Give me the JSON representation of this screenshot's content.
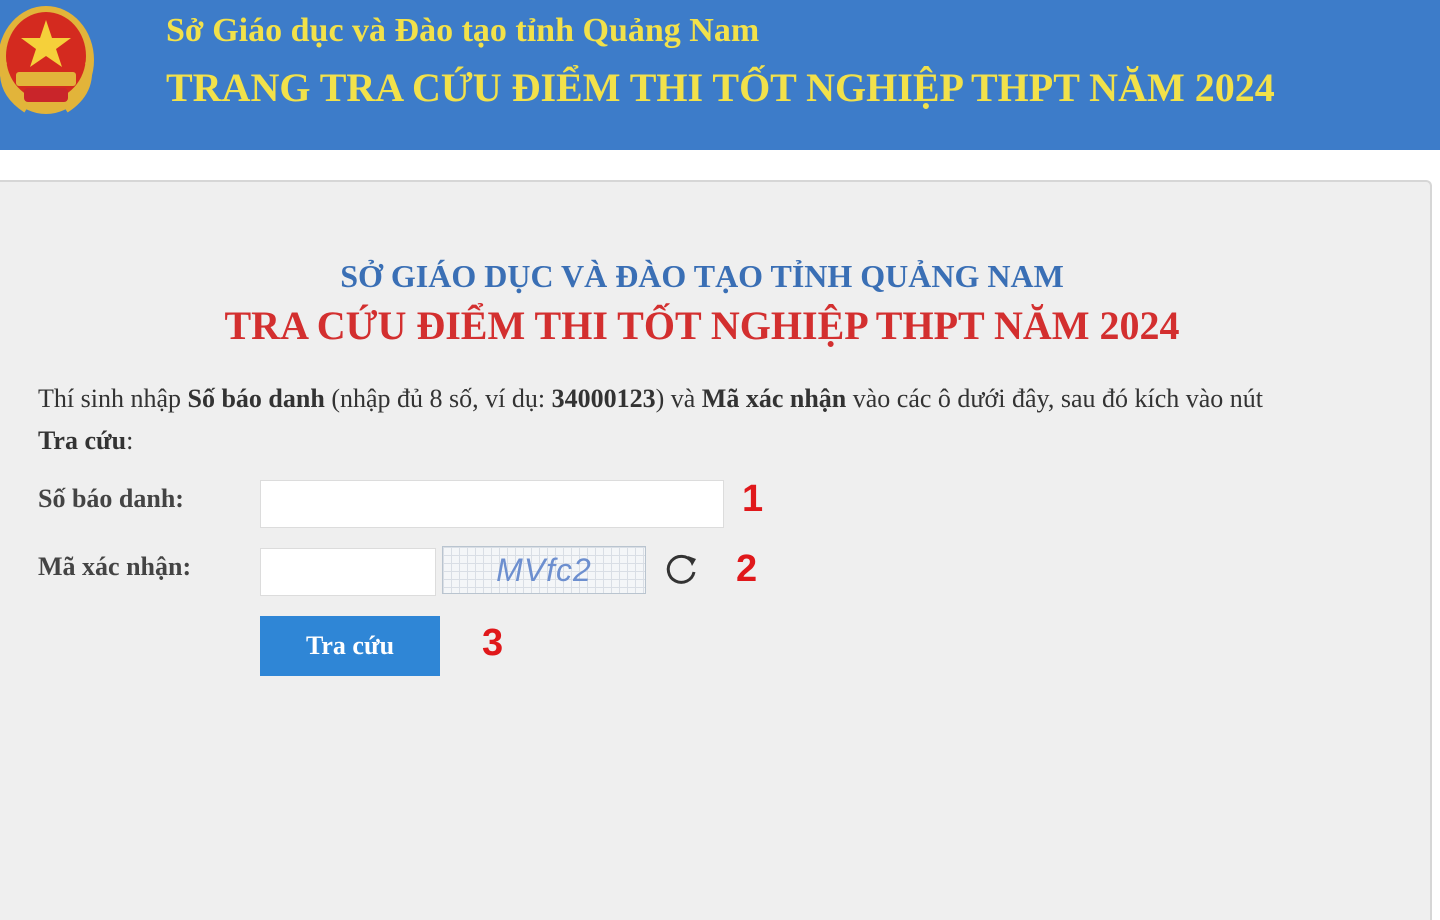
{
  "header": {
    "line1": "Sở Giáo dục và Đào tạo tỉnh Quảng Nam",
    "line2": "TRANG TRA CỨU ĐIỂM THI TỐT NGHIỆP THPT NĂM 2024"
  },
  "panel": {
    "org": "SỞ GIÁO DỤC VÀ ĐÀO TẠO TỈNH QUẢNG NAM",
    "title": "TRA CỨU ĐIỂM THI TỐT NGHIỆP THPT NĂM 2024",
    "instruction": {
      "p1": "Thí sinh nhập ",
      "b1": "Số báo danh",
      "p2": " (nhập đủ 8 số, ví dụ: ",
      "b2": "34000123",
      "p3": ") và ",
      "b3": "Mã xác nhận",
      "p4": " vào các ô dưới đây, sau đó kích vào nút ",
      "b4": "Tra cứu",
      "p5": ":"
    }
  },
  "form": {
    "sbd_label": "Số báo danh:",
    "sbd_value": "",
    "captcha_label": "Mã xác nhận:",
    "captcha_value": "",
    "captcha_text": "MVfc2",
    "submit_label": "Tra cứu"
  },
  "markers": [
    "1",
    "2",
    "3"
  ],
  "icons": {
    "refresh": "refresh-icon",
    "emblem": "national-emblem-icon"
  },
  "colors": {
    "header_bg": "#3d7cc9",
    "header_text": "#f2e14a",
    "title_red": "#d32f2f",
    "org_blue": "#3a6fb5",
    "button_bg": "#2f86d6",
    "marker_red": "#e0181b"
  }
}
